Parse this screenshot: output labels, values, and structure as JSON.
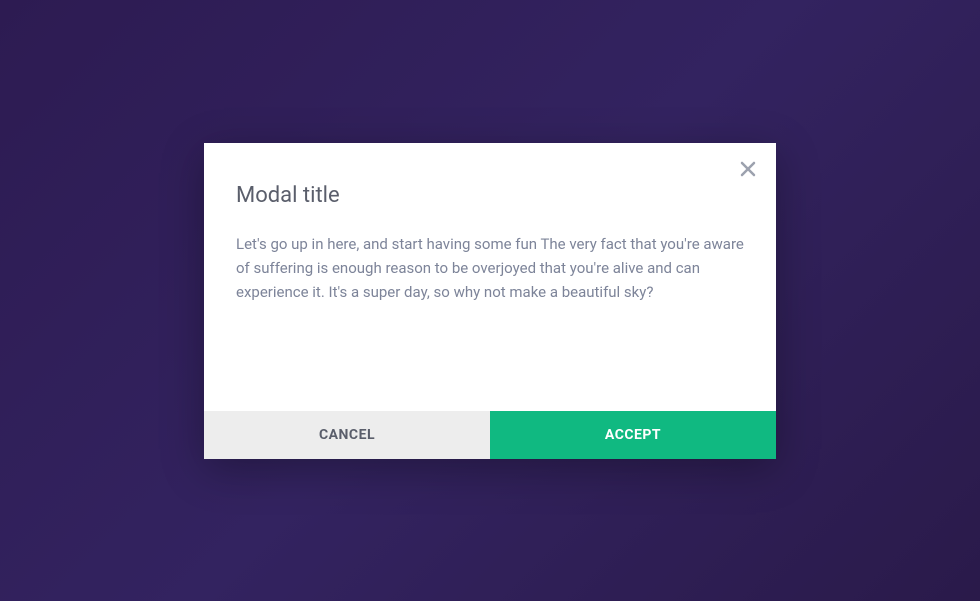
{
  "modal": {
    "title": "Modal title",
    "body": "Let's go up in here, and start having some fun The very fact that you're aware of suffering is enough reason to be overjoyed that you're alive and can experience it. It's a super day, so why not make a beautiful sky?",
    "actions": {
      "cancel_label": "CANCEL",
      "accept_label": "ACCEPT"
    }
  }
}
